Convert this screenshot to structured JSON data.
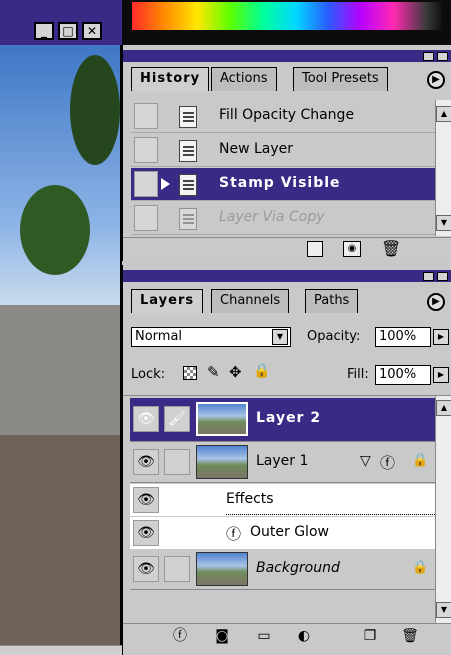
{
  "window": {
    "min_icon": "minimize-icon",
    "max_icon": "maximize-icon",
    "close_icon": "close-icon",
    "min": "_",
    "max": "□",
    "close": "✕"
  },
  "history": {
    "tabs": [
      "History",
      "Actions",
      "Tool Presets"
    ],
    "items": [
      {
        "label": "Fill Opacity Change"
      },
      {
        "label": "New Layer"
      },
      {
        "label": "Stamp Visible"
      },
      {
        "label": "Layer Via Copy"
      }
    ]
  },
  "layers": {
    "tabs": [
      "Layers",
      "Channels",
      "Paths"
    ],
    "blend_mode": "Normal",
    "opacity_label": "Opacity:",
    "opacity_value": "100%",
    "lock_label": "Lock:",
    "fill_label": "Fill:",
    "fill_value": "100%",
    "rows": [
      {
        "name": "Layer 2"
      },
      {
        "name": "Layer 1"
      },
      {
        "name": "Effects"
      },
      {
        "name": "Outer Glow"
      },
      {
        "name": "Background"
      }
    ]
  },
  "colors": {
    "titlebar": "#3a2a86",
    "selection": "#3a2a86",
    "panel": "#c9c9c9"
  }
}
